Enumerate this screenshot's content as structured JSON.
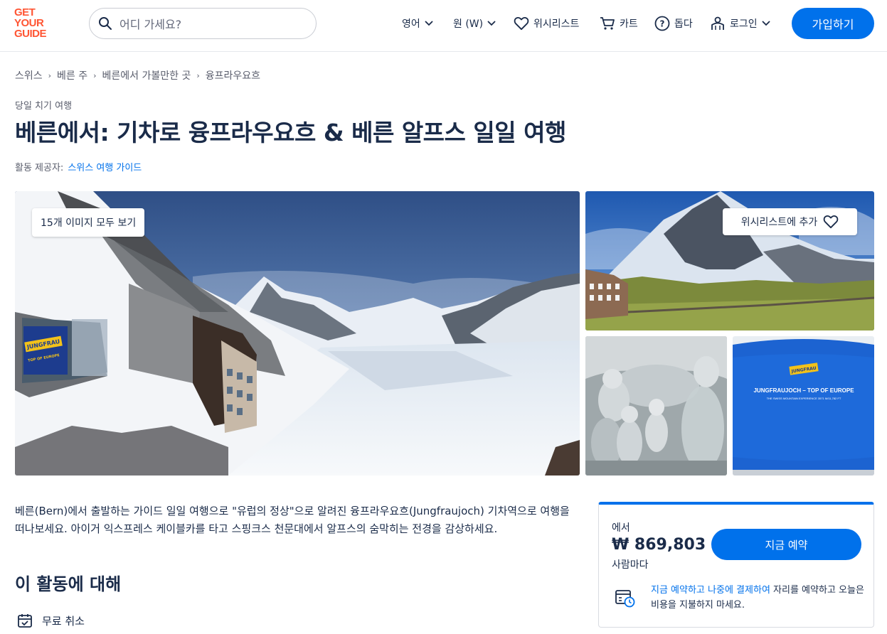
{
  "header": {
    "logo": [
      "GET",
      "YOUR",
      "GUIDE"
    ],
    "search_placeholder": "어디 가세요?",
    "language": "영어",
    "currency": "원 (W)",
    "wishlist": "위시리스트",
    "cart": "카트",
    "help": "돕다",
    "login": "로그인",
    "signup": "가입하기"
  },
  "breadcrumb": [
    "스위스",
    "베른 주",
    "베른에서 가볼만한 곳",
    "융프라우요흐"
  ],
  "activity": {
    "category": "당일 치기 여행",
    "title": "베른에서: 기차로 융프라우요흐 & 베른 알프스 일일 여행",
    "provider_label": "활동 제공자:",
    "provider_name": "스위스 여행 가이드"
  },
  "gallery": {
    "view_all": "15개 이미지 모두 보기",
    "add_wishlist": "위시리스트에 추가",
    "sign_brand": "JUNGFRAU",
    "sign_sub": "TOP OF EUROPE",
    "sign_line1": "JUNGFRAUJOCH – TOP OF EUROPE",
    "sign_line2": "THE SWISS MOUNTAIN EXPERIENCE      3571 M/11,782 FT"
  },
  "description": "베른(Bern)에서 출발하는 가이드 일일 여행으로 \"유럽의 정상\"으로 알려진 융프라우요흐(Jungfraujoch) 기차역으로 여행을 떠나보세요. 아이거 익스프레스 케이블카를 타고 스핑크스 천문대에서 알프스의 숨막히는 전경을 감상하세요.",
  "about": {
    "title": "이 활동에 대해",
    "features": [
      "무료 취소"
    ]
  },
  "booking": {
    "from": "에서",
    "price": "₩ 869,803",
    "per": "사람마다",
    "book_now": "지금 예약",
    "rnpl_link1": "지금 예약하고",
    "rnpl_link2": "나중에 결제하여",
    "rnpl_rest": "자리를 예약하고 오늘은 비용을 지불하지 마세요."
  },
  "colors": {
    "brand": "#ff5533",
    "primary": "#0071eb",
    "text": "#1a2b49"
  }
}
